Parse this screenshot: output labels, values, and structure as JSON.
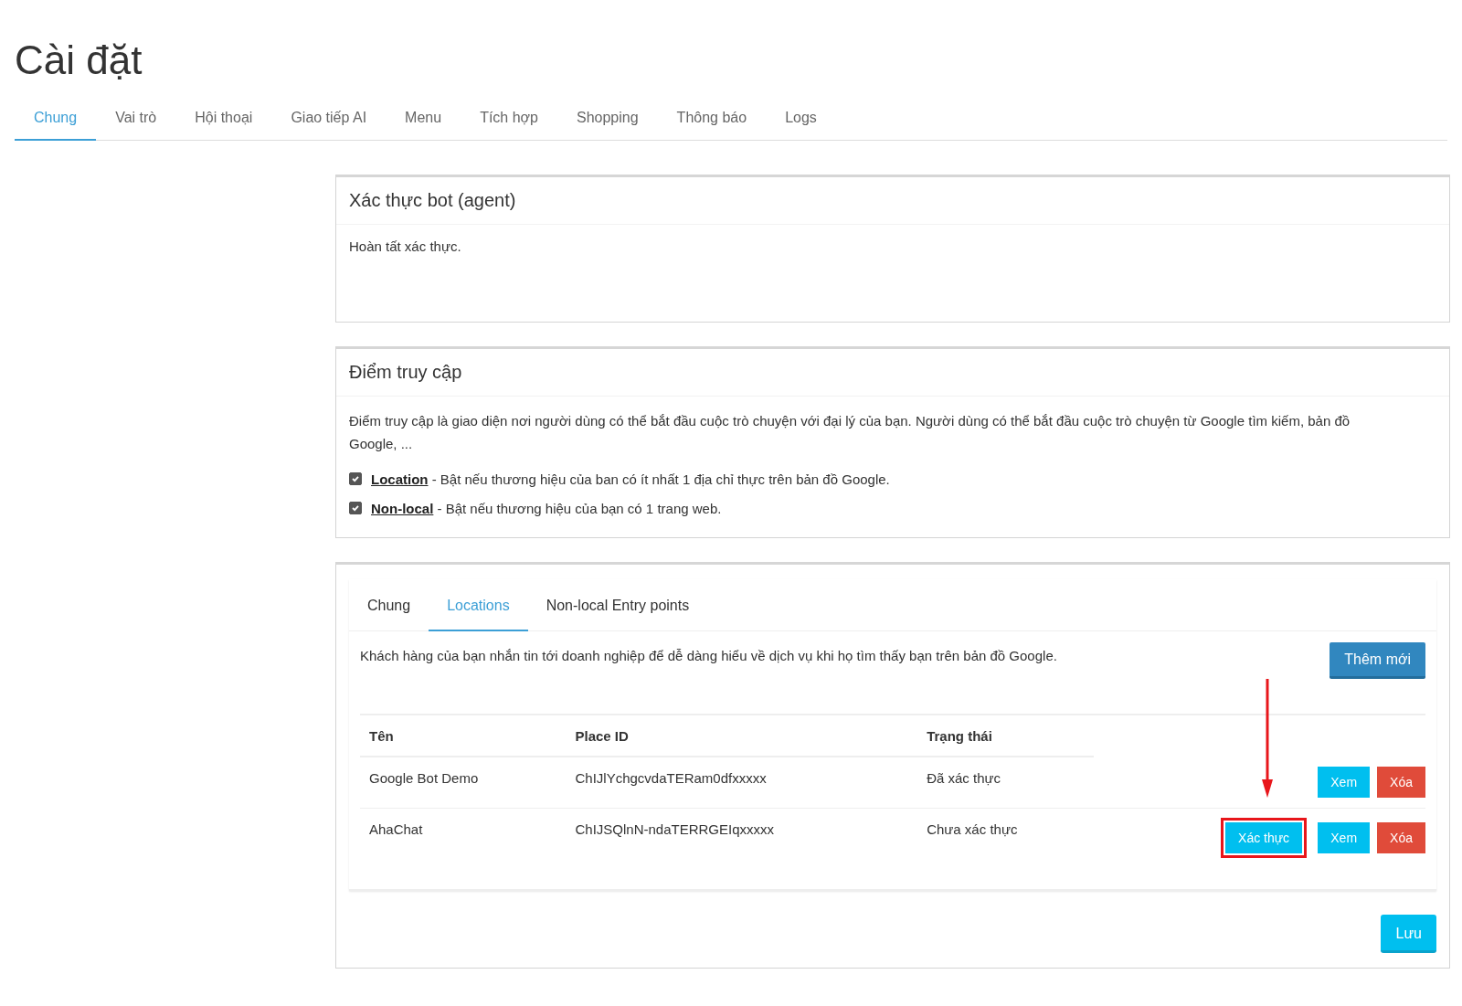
{
  "page_title": "Cài đặt",
  "tabs": [
    {
      "label": "Chung",
      "selected": true
    },
    {
      "label": "Vai trò",
      "selected": false
    },
    {
      "label": "Hội thoại",
      "selected": false
    },
    {
      "label": "Giao tiếp AI",
      "selected": false
    },
    {
      "label": "Menu",
      "selected": false
    },
    {
      "label": "Tích hợp",
      "selected": false
    },
    {
      "label": "Shopping",
      "selected": false
    },
    {
      "label": "Thông báo",
      "selected": false
    },
    {
      "label": "Logs",
      "selected": false
    }
  ],
  "auth_card": {
    "title": "Xác thực bot (agent)",
    "text": "Hoàn tất xác thực."
  },
  "entry_card": {
    "title": "Điểm truy cập",
    "description": "Điểm truy cập là giao diện nơi người dùng có thể bắt đầu cuộc trò chuyện với đại lý của bạn. Người dùng có thể bắt đầu cuộc trò chuyện từ Google tìm kiếm, bản đồ Google, ...",
    "options": [
      {
        "link": "Location",
        "text": " - Bật nếu thương hiệu của ban có ít nhất 1 địa chỉ thực trên bản đồ Google.",
        "checked": true
      },
      {
        "link": "Non-local",
        "text": " - Bật nếu thương hiệu của bạn có 1 trang web.",
        "checked": true
      }
    ]
  },
  "locations_card": {
    "tabs": [
      {
        "label": "Chung",
        "selected": false
      },
      {
        "label": "Locations",
        "selected": true
      },
      {
        "label": "Non-local Entry points",
        "selected": false
      }
    ],
    "description": "Khách hàng của bạn nhắn tin tới doanh nghiệp để dễ dàng hiểu về dịch vụ khi họ tìm thấy bạn trên bản đồ Google.",
    "add_button": "Thêm mới",
    "table": {
      "columns": [
        "Tên",
        "Place ID",
        "Trạng thái"
      ],
      "rows": [
        {
          "name": "Google Bot Demo",
          "place_id": "ChIJlYchgcvdaTERam0dfxxxxx",
          "status": "Đã xác thực",
          "actions": [
            {
              "kind": "view",
              "label": "Xem",
              "highlighted": false
            },
            {
              "kind": "delete",
              "label": "Xóa",
              "highlighted": false
            }
          ]
        },
        {
          "name": "AhaChat",
          "place_id": "ChIJSQlnN-ndaTERRGEIqxxxxx",
          "status": "Chưa xác thực",
          "actions": [
            {
              "kind": "verify",
              "label": "Xác thực",
              "highlighted": true
            },
            {
              "kind": "view",
              "label": "Xem",
              "highlighted": false
            },
            {
              "kind": "delete",
              "label": "Xóa",
              "highlighted": false
            }
          ]
        }
      ]
    },
    "save_button": "Lưu"
  }
}
